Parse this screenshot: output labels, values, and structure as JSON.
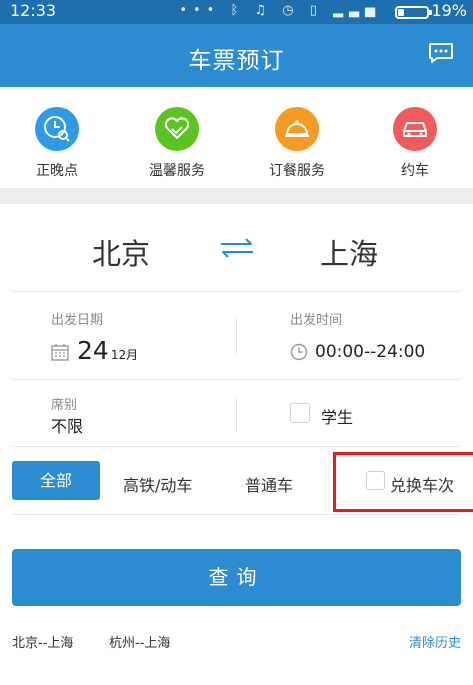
{
  "status": {
    "time": "12:33",
    "battery": "19%",
    "icons": [
      "more-dots-icon",
      "bluetooth-icon",
      "notifications-off-icon",
      "alarm-icon",
      "vibrate-icon",
      "signal-icon",
      "battery-icon"
    ]
  },
  "header": {
    "title": "车票预订",
    "message_icon": "chat-bubble-icon"
  },
  "quick_actions": [
    {
      "label": "正晚点",
      "icon": "clock-search-icon",
      "color": "#2d9be6"
    },
    {
      "label": "温馨服务",
      "icon": "handshake-heart-icon",
      "color": "#5cc421"
    },
    {
      "label": "订餐服务",
      "icon": "food-cloche-icon",
      "color": "#f59a23"
    },
    {
      "label": "约车",
      "icon": "car-icon",
      "color": "#f25b5b"
    }
  ],
  "route": {
    "from": "北京",
    "to": "上海",
    "swap_icon": "swap-arrows-icon"
  },
  "form": {
    "date_label": "出发日期",
    "date_day": "24",
    "date_month": "12月",
    "time_label": "出发时间",
    "time_value": "00:00--24:00",
    "seat_label": "席别",
    "seat_value": "不限",
    "student_label": "学生"
  },
  "filters": {
    "all": "全部",
    "high_speed": "高铁/动车",
    "normal": "普通车",
    "exchange": "兑换车次"
  },
  "query_button": "查询",
  "history": {
    "items": [
      "北京--上海",
      "杭州--上海"
    ],
    "clear": "清除历史"
  },
  "colors": {
    "primary": "#2d8bd1",
    "status_bar": "#1f6fae",
    "highlight_box": "#e01c1c"
  }
}
